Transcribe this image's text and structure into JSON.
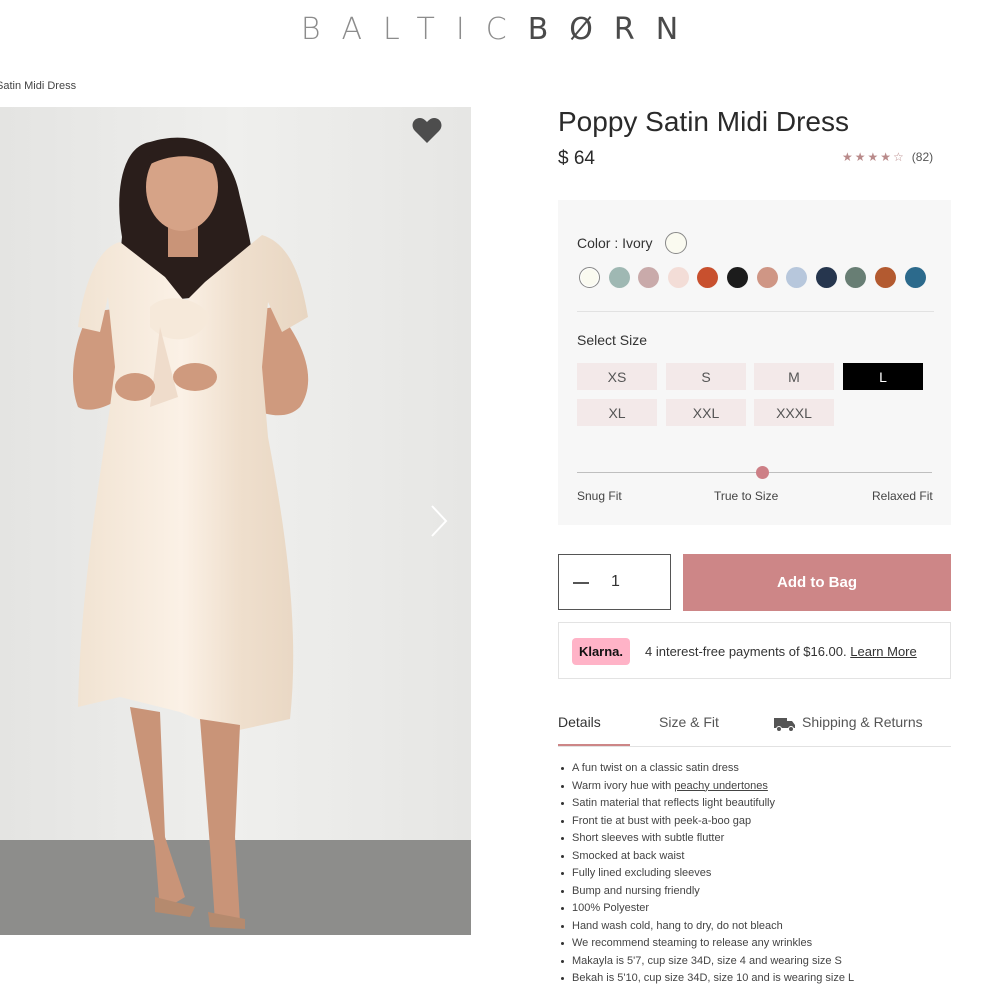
{
  "brand": {
    "part1": "BALTIC",
    "part2": "BØRN"
  },
  "breadcrumb": "Satin Midi Dress",
  "product": {
    "title": "Poppy Satin Midi Dress",
    "price": "$ 64",
    "rating_stars": "★★★★☆",
    "rating_value": 4,
    "review_count": "(82)"
  },
  "options": {
    "color_label": "Color :",
    "color_value": "Ivory",
    "swatches": [
      "#fafaf0",
      "#9fb8b3",
      "#c9aaaa",
      "#f3ddd7",
      "#c8502e",
      "#1c1c1c",
      "#cf9685",
      "#b7c7dc",
      "#26364e",
      "#687e74",
      "#b35a30",
      "#2c6a8c"
    ],
    "size_label": "Select Size",
    "sizes": [
      "XS",
      "S",
      "M",
      "L",
      "XL",
      "XXL",
      "XXXL"
    ],
    "selected_size": "L",
    "fit": {
      "left": "Snug Fit",
      "center": "True to Size",
      "right": "Relaxed Fit",
      "value": 0.5
    }
  },
  "cart": {
    "quantity": "1",
    "add_label": "Add to Bag"
  },
  "klarna": {
    "badge": "Klarna.",
    "text": "4 interest-free payments of $16.00.",
    "link": "Learn More"
  },
  "tabs": {
    "details": "Details",
    "size_fit": "Size & Fit",
    "shipping": "Shipping & Returns"
  },
  "details": {
    "items": [
      "A fun twist on a classic satin dress",
      "Warm ivory hue with",
      "Satin material that reflects light beautifully",
      "Front tie at bust with peek-a-boo gap",
      "Short sleeves with subtle flutter",
      "Smocked at back waist",
      "Fully lined excluding sleeves",
      "Bump and nursing friendly",
      "100% Polyester",
      "Hand wash cold, hang to dry, do not bleach",
      "We recommend steaming to release any wrinkles",
      "Makayla is 5'7, cup size 34D, size 4 and wearing size S",
      "Bekah is 5'10, cup size 34D, size 10 and is wearing size L"
    ],
    "link_text": "peachy undertones"
  },
  "colors": {
    "accent": "#cd8687",
    "klarna_pink": "#ffb3c7"
  }
}
